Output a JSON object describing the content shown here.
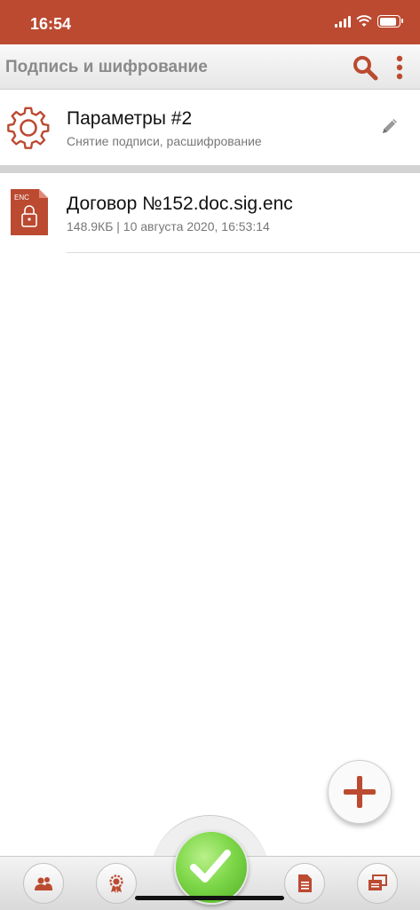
{
  "status_bar": {
    "time": "16:54"
  },
  "toolbar": {
    "title": "Подпись и шифрование"
  },
  "settings_item": {
    "title": "Параметры #2",
    "subtitle": "Снятие подписи, расшифрование"
  },
  "files": [
    {
      "name": "Договор №152.doc.sig.enc",
      "meta": "148.9КБ | 10 августа 2020, 16:53:14",
      "icon_badge": "ENC"
    }
  ],
  "colors": {
    "accent": "#bb4a31",
    "confirm": "#6cc83c"
  },
  "icons": {
    "toolbar": [
      "search-icon",
      "more-vertical-icon"
    ],
    "settings": [
      "gear-icon",
      "pencil-icon"
    ],
    "file": "encrypted-file-icon",
    "fab": "plus-icon",
    "bottom_tabs": [
      "contacts-icon",
      "certificate-icon",
      "checkmark-icon",
      "document-icon",
      "windows-icon"
    ]
  }
}
